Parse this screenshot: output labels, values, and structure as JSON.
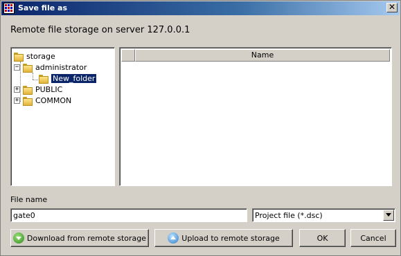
{
  "window": {
    "title": "Save file as",
    "close_glyph": "✕"
  },
  "heading": "Remote file storage on server 127.0.0.1",
  "tree": {
    "items": [
      {
        "label": "storage",
        "expander": "",
        "icon": "folder-icon"
      },
      {
        "label": "administrator",
        "expander": "−",
        "icon": "folder-icon"
      },
      {
        "label": "New_folder",
        "expander": "",
        "icon": "folder-open-icon",
        "selected": true
      },
      {
        "label": "PUBLIC",
        "expander": "+",
        "icon": "folder-icon"
      },
      {
        "label": "COMMON",
        "expander": "+",
        "icon": "folder-icon"
      }
    ]
  },
  "file_list": {
    "columns": [
      "",
      "Name"
    ],
    "rows": []
  },
  "file_name": {
    "label": "File name",
    "value": "gate0"
  },
  "file_type": {
    "selected": "Project file (*.dsc)"
  },
  "buttons": {
    "download": "Download from remote storage",
    "upload": "Upload to remote storage",
    "ok": "OK",
    "cancel": "Cancel"
  },
  "colors": {
    "titlebar": "#0a246a",
    "window_bg": "#d4d0c8",
    "selection": "#0a246a"
  }
}
